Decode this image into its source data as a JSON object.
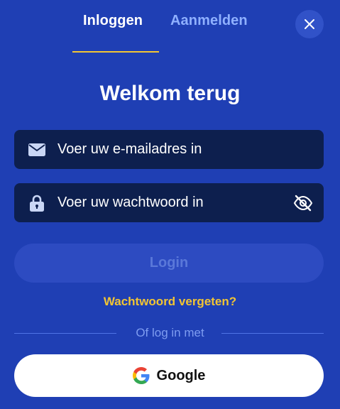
{
  "tabs": {
    "login": "Inloggen",
    "register": "Aanmelden"
  },
  "title": "Welkom terug",
  "email": {
    "placeholder": "Voer uw e-mailadres in",
    "value": ""
  },
  "password": {
    "placeholder": "Voer uw wachtwoord in",
    "value": ""
  },
  "login_button": "Login",
  "forgot_link": "Wachtwoord vergeten?",
  "divider_text": "Of log in met",
  "google_button": "Google",
  "icons": {
    "close": "close-icon",
    "email": "envelope-icon",
    "password": "lock-icon",
    "visibility": "eye-off-icon",
    "google": "google-logo-icon"
  },
  "colors": {
    "background": "#1f3fb4",
    "input_background": "#0d1f4e",
    "accent": "#f2c533",
    "inactive_tab": "#8fb0ff",
    "login_button_disabled": "#2d4bc1"
  }
}
